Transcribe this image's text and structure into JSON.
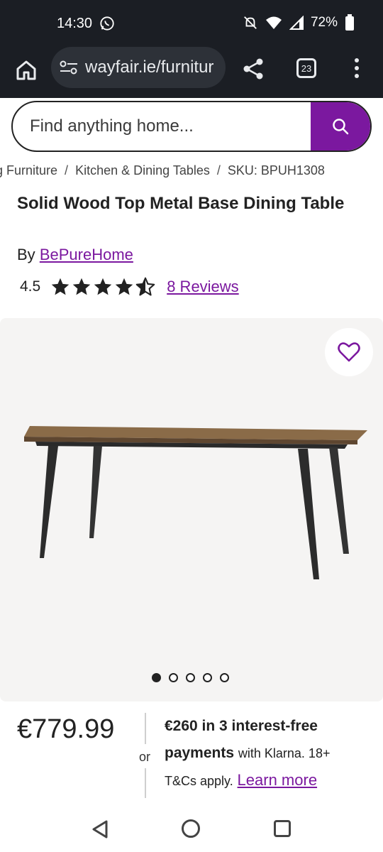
{
  "status_bar": {
    "time": "14:30",
    "battery": "72%"
  },
  "browser": {
    "url": "wayfair.ie/furnitur",
    "tab_count": "23"
  },
  "search": {
    "placeholder": "Find anything home..."
  },
  "breadcrumb": {
    "items": [
      "g Furniture",
      "Kitchen & Dining Tables",
      "SKU: BPUH1308"
    ],
    "separator": "/"
  },
  "product": {
    "title": "Solid Wood Top Metal Base Dining Table",
    "by_label": "By",
    "brand": "BePureHome",
    "rating": "4.5",
    "rating_stars": 4.5,
    "reviews_label": "8 Reviews"
  },
  "gallery": {
    "image_count": 5,
    "active_index": 0,
    "favorite_icon": "heart-outline-icon"
  },
  "pricing": {
    "price": "€779.99",
    "or_label": "or",
    "klarna_bold_1": "€260 in 3 interest-free",
    "klarna_bold_2": "payments",
    "klarna_text_1": "with Klarna. 18+",
    "klarna_text_2": "T&Cs apply.",
    "learn_more": "Learn more"
  },
  "colors": {
    "brand": "#7b189f",
    "status_bg": "#1b1e24"
  }
}
